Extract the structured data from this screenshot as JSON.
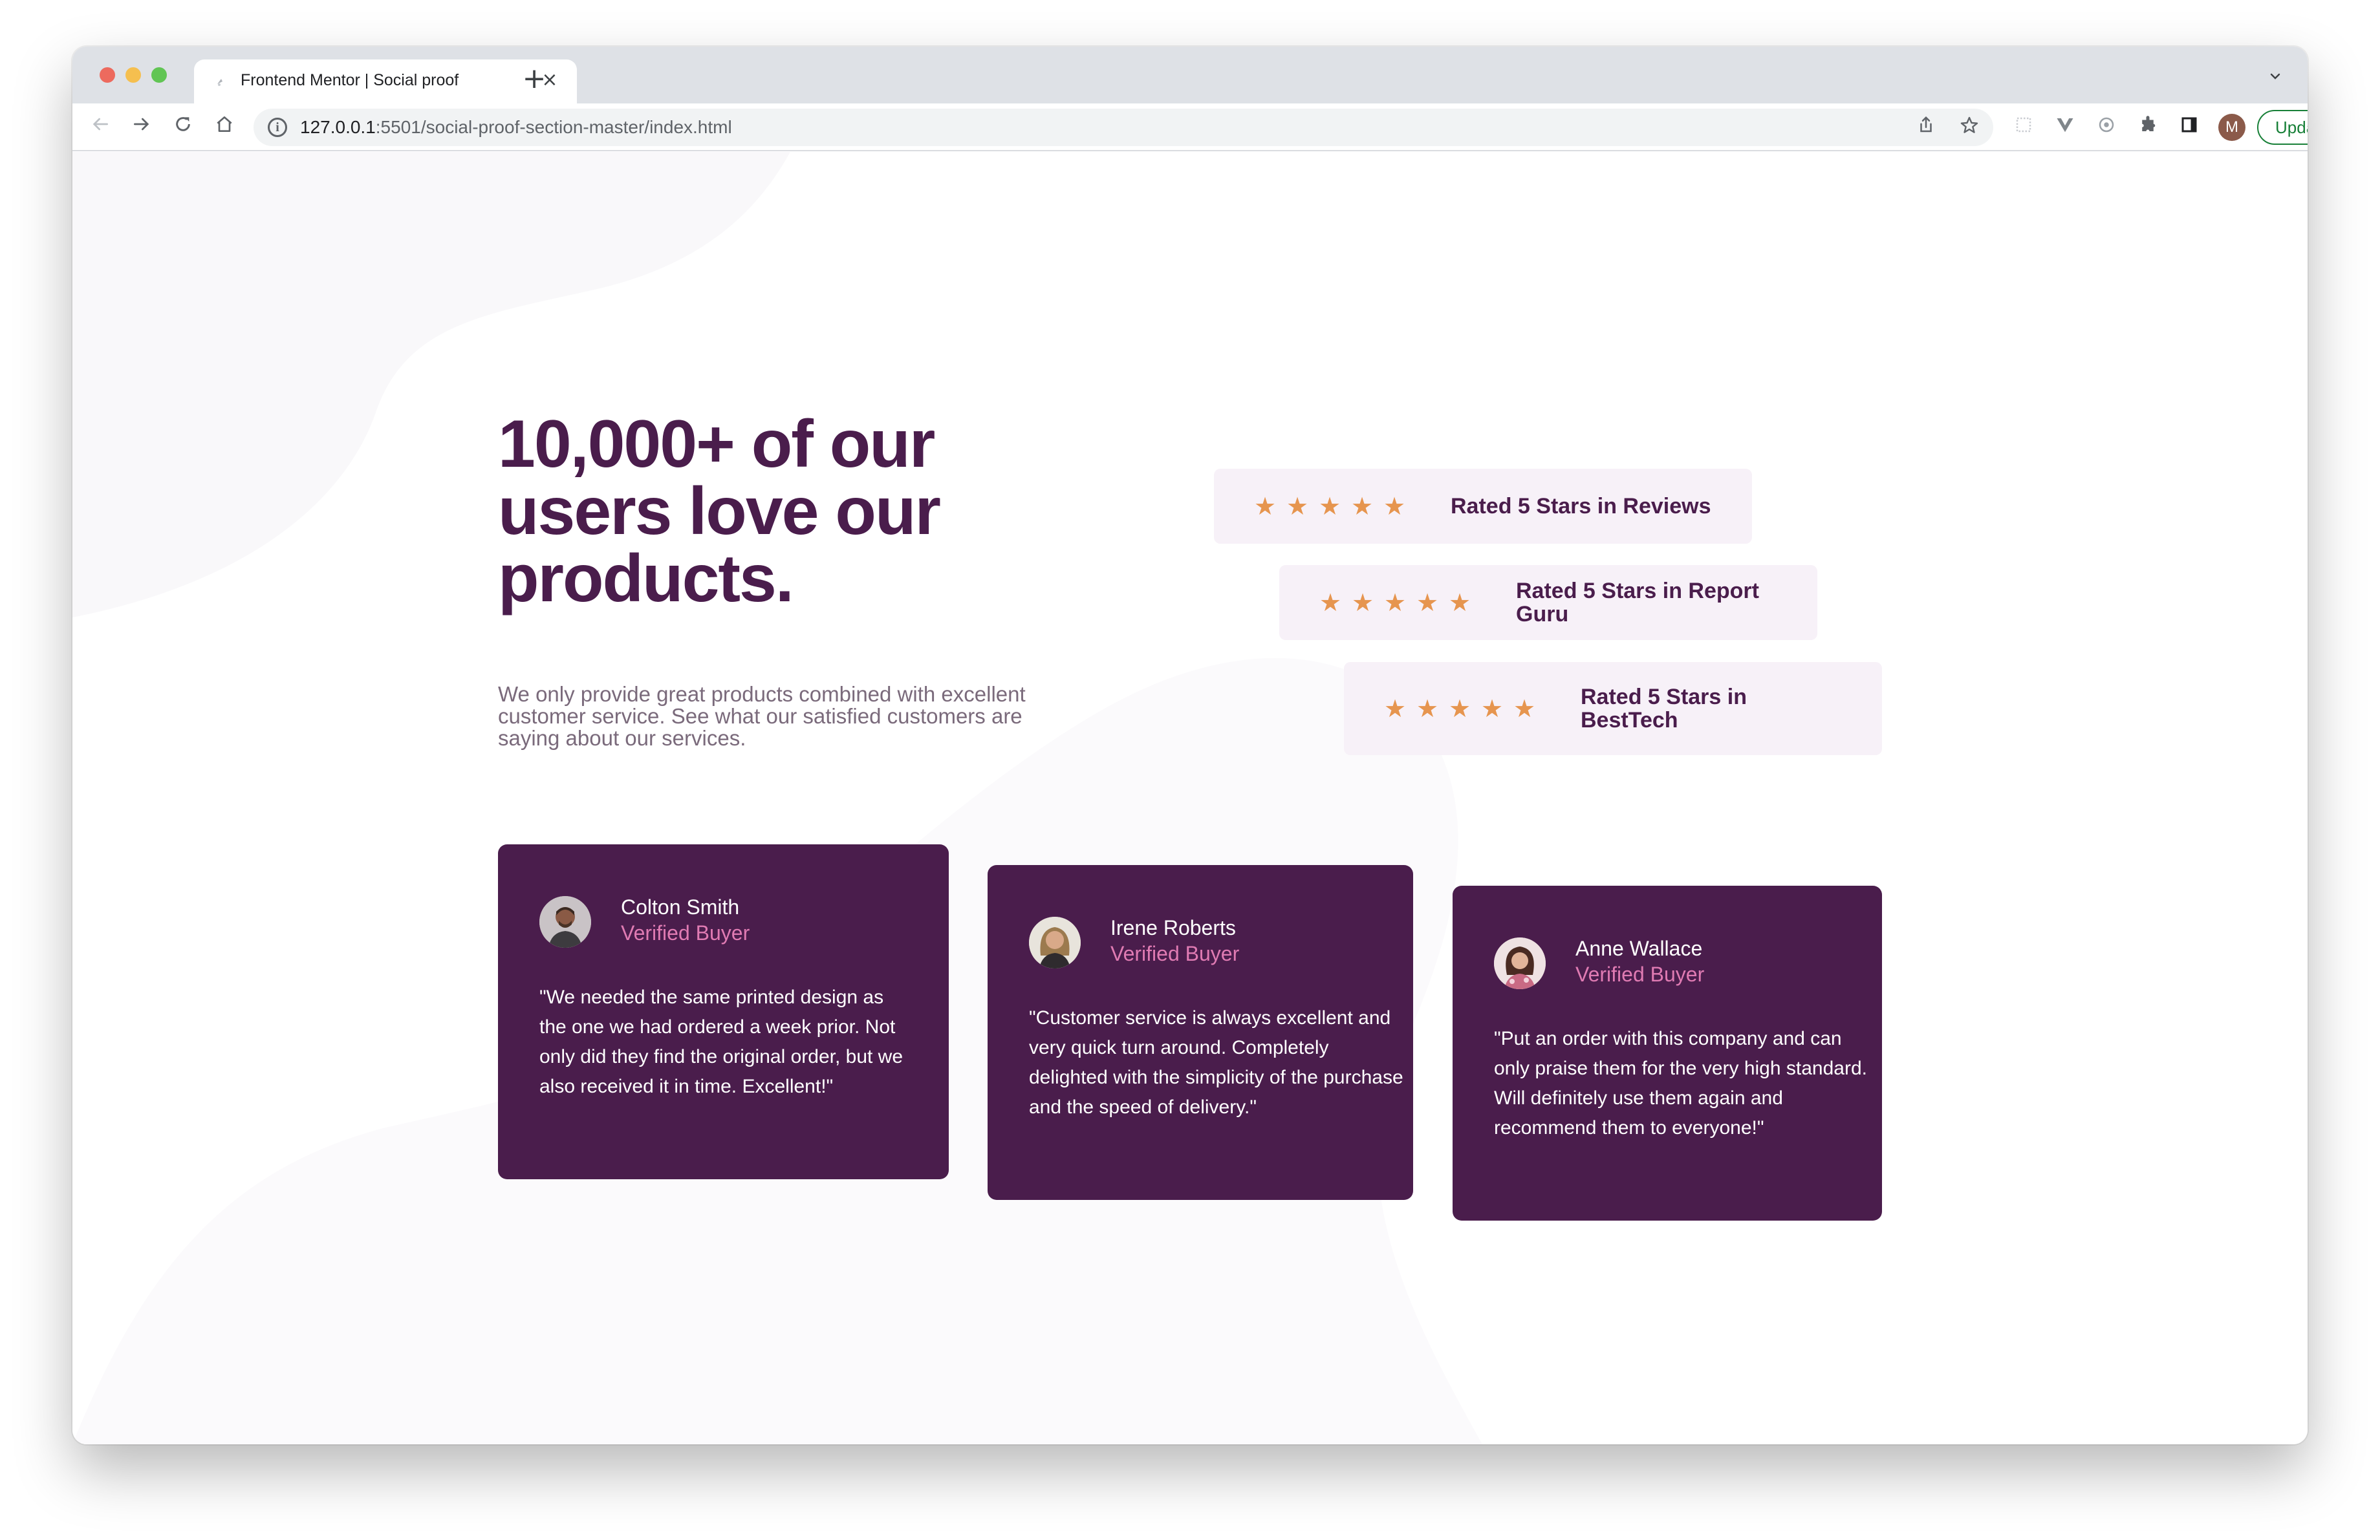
{
  "browser": {
    "tab_title": "Frontend Mentor | Social proof",
    "tab_close": "×",
    "new_tab": "+",
    "tab_list": "⌄",
    "url_host": "127.0.0.1",
    "url_rest": ":5501/social-proof-section-master/index.html",
    "profile_initial": "M",
    "update_label": "Update",
    "update_menu": "⋮",
    "icons": {
      "back": "back-arrow-icon",
      "forward": "forward-arrow-icon",
      "reload": "reload-icon",
      "home": "home-icon",
      "info": "info-icon",
      "share": "share-icon",
      "bookmark": "star-outline-icon",
      "extensions": "puzzle-icon",
      "side_panel": "side-panel-icon"
    }
  },
  "page": {
    "headline": "10,000+ of our users love our products.",
    "subtext": "We only provide great products combined with excellent customer service. See what our satisfied customers are saying about our services.",
    "star_glyph": "★",
    "ratings": [
      {
        "label": "Rated 5 Stars in Reviews",
        "stars": 5
      },
      {
        "label": "Rated 5 Stars in Report Guru",
        "stars": 5
      },
      {
        "label": "Rated 5 Stars in BestTech",
        "stars": 5
      }
    ],
    "testimonials": [
      {
        "name": "Colton Smith",
        "role": "Verified Buyer",
        "quote": "\"We needed the same printed design as the one we had ordered a week prior. Not only did they find the original order, but we also received it in time. Excellent!\""
      },
      {
        "name": "Irene Roberts",
        "role": "Verified Buyer",
        "quote": "\"Customer service is always excellent and very quick turn around. Completely delighted with the simplicity of the purchase and the speed of delivery.\""
      },
      {
        "name": "Anne Wallace",
        "role": "Verified Buyer",
        "quote": "\"Put an order with this company and can only praise them for the very high standard. Will definitely use them again and recommend them to everyone!\""
      }
    ],
    "colors": {
      "primary": "#4a1d4c",
      "accent": "#e07bb3",
      "star": "#e6954f",
      "rating_bg": "#f7f1f8",
      "text_muted": "#7a6a7b"
    }
  }
}
